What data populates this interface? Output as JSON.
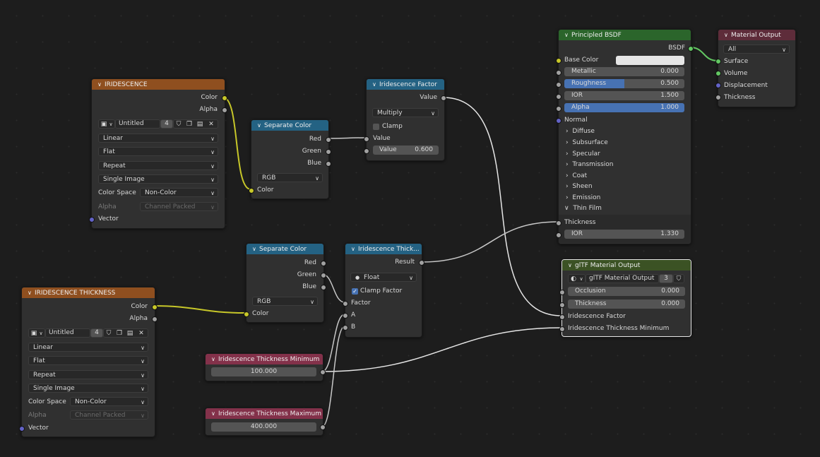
{
  "iridescence": {
    "title": "IRIDESCENCE",
    "out_color": "Color",
    "out_alpha": "Alpha",
    "image_name": "Untitled",
    "users": "4",
    "interpolation": "Linear",
    "projection": "Flat",
    "extension": "Repeat",
    "source": "Single Image",
    "color_space_label": "Color Space",
    "color_space": "Non-Color",
    "alpha_label": "Alpha",
    "alpha_value": "Channel Packed",
    "in_vector": "Vector"
  },
  "iridescence_thickness": {
    "title": "IRIDESCENCE THICKNESS",
    "out_color": "Color",
    "out_alpha": "Alpha",
    "image_name": "Untitled",
    "users": "4",
    "interpolation": "Linear",
    "projection": "Flat",
    "extension": "Repeat",
    "source": "Single Image",
    "color_space_label": "Color Space",
    "color_space": "Non-Color",
    "alpha_label": "Alpha",
    "alpha_value": "Channel Packed",
    "in_vector": "Vector"
  },
  "separate_color_1": {
    "title": "Separate Color",
    "out_red": "Red",
    "out_green": "Green",
    "out_blue": "Blue",
    "mode": "RGB",
    "in_color": "Color"
  },
  "separate_color_2": {
    "title": "Separate Color",
    "out_red": "Red",
    "out_green": "Green",
    "out_blue": "Blue",
    "mode": "RGB",
    "in_color": "Color"
  },
  "iridescence_factor": {
    "title": "Iridescence Factor",
    "out_value": "Value",
    "operation": "Multiply",
    "clamp_label": "Clamp",
    "in_value": "Value",
    "value_label": "Value",
    "value": "0.600"
  },
  "iridescence_thickness_map": {
    "title": "Iridescence Thick...",
    "out_result": "Result",
    "data_type": "Float",
    "clamp_label": "Clamp Factor",
    "in_factor": "Factor",
    "in_a": "A",
    "in_b": "B"
  },
  "thickness_min": {
    "title": "Iridescence Thickness Minimum",
    "value": "100.000"
  },
  "thickness_max": {
    "title": "Iridescence Thickness Maximum",
    "value": "400.000"
  },
  "principled": {
    "title": "Principled BSDF",
    "out_bsdf": "BSDF",
    "base_color": "Base Color",
    "metallic_label": "Metallic",
    "metallic": "0.000",
    "roughness_label": "Roughness",
    "roughness": "0.500",
    "ior_label": "IOR",
    "ior": "1.500",
    "alpha_label": "Alpha",
    "alpha": "1.000",
    "normal": "Normal",
    "panels": [
      "Diffuse",
      "Subsurface",
      "Specular",
      "Transmission",
      "Coat",
      "Sheen",
      "Emission",
      "Thin Film"
    ],
    "thickness": "Thickness",
    "thin_ior_label": "IOR",
    "thin_ior": "1.330"
  },
  "material_output": {
    "title": "Material Output",
    "target": "All",
    "in_surface": "Surface",
    "in_volume": "Volume",
    "in_displacement": "Displacement",
    "in_thickness": "Thickness"
  },
  "gltf_output": {
    "title": "glTF Material Output",
    "group_name": "glTF Material Output",
    "users": "3",
    "occlusion_label": "Occlusion",
    "occlusion": "0.000",
    "thickness_label": "Thickness",
    "thickness": "0.000",
    "in_iridescence_factor": "Iridescence Factor",
    "in_iridescence_thickness_min": "Iridescence Thickness Minimum"
  },
  "colors": {
    "texture_header": "#8f4f1f",
    "converter_header": "#246283",
    "shader_header": "#2b652b",
    "output_header": "#5e2c3a",
    "group_header": "#3b5224",
    "input_header": "#83314a",
    "socket_color": "#c7c729",
    "socket_float": "#a1a1a1",
    "socket_vector": "#6363c7",
    "socket_shader": "#63c763",
    "slider_fill": "#4772b3"
  },
  "icons": [
    "chevron-down-icon",
    "image-icon",
    "shield-icon",
    "duplicate-icon",
    "pack-icon",
    "close-icon",
    "chevron-right-icon",
    "checkbox-icon",
    "node-group-icon"
  ]
}
